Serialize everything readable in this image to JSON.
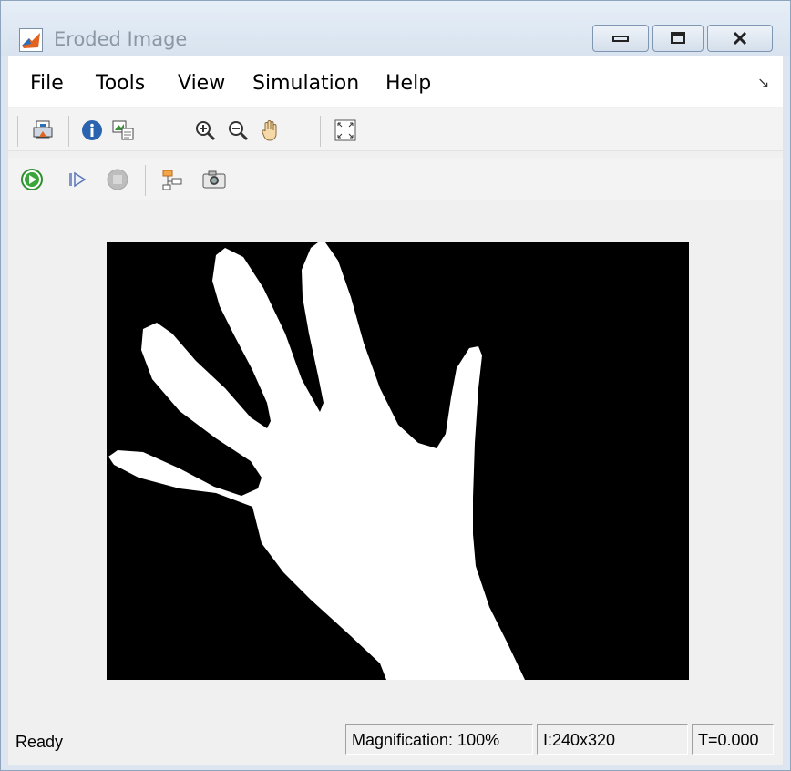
{
  "window": {
    "title": "Eroded Image",
    "app_icon": "matlab-icon"
  },
  "menu": {
    "items": [
      "File",
      "Tools",
      "View",
      "Simulation",
      "Help"
    ],
    "dock_icon": "dock-arrow-icon"
  },
  "toolbar1": {
    "icons": [
      "print-to-figure-icon",
      "info-icon",
      "export-icon",
      "zoom-in-icon",
      "zoom-out-icon",
      "pan-hand-icon",
      "fit-to-view-icon"
    ]
  },
  "toolbar2": {
    "icons": [
      "run-icon",
      "step-forward-icon",
      "stop-icon",
      "highlight-model-icon",
      "snapshot-camera-icon"
    ]
  },
  "image": {
    "content": "binary eroded hand silhouette"
  },
  "status": {
    "ready": "Ready",
    "magnification": "Magnification: 100%",
    "dimensions": "I:240x320",
    "time": "T=0.000"
  },
  "colors": {
    "window_frame": "#dde6f0",
    "client_bg": "#f0f0f0",
    "image_bg": "#000000",
    "image_fg": "#ffffff",
    "run_green": "#3aa53a"
  }
}
